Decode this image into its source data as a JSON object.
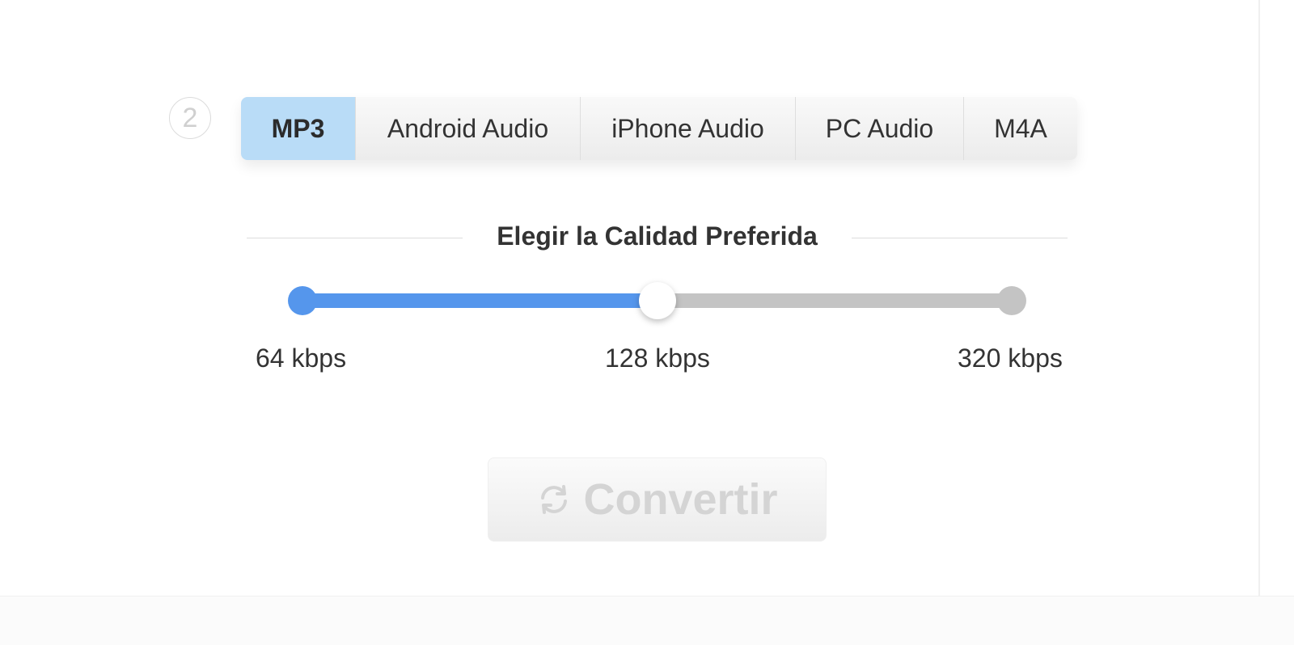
{
  "step": {
    "number": "2"
  },
  "format_tabs": {
    "selected_index": 0,
    "items": [
      {
        "label": "MP3"
      },
      {
        "label": "Android Audio"
      },
      {
        "label": "iPhone Audio"
      },
      {
        "label": "PC Audio"
      },
      {
        "label": "M4A"
      }
    ]
  },
  "quality": {
    "title": "Elegir la Calidad Preferida",
    "options": [
      "64 kbps",
      "128 kbps",
      "320 kbps"
    ],
    "selected_index": 1,
    "fill_fraction": 0.5,
    "colors": {
      "active": "#5596ec",
      "inactive": "#c4c4c4"
    }
  },
  "convert": {
    "label": "Convertir",
    "icon": "refresh-icon",
    "state": "disabled"
  }
}
